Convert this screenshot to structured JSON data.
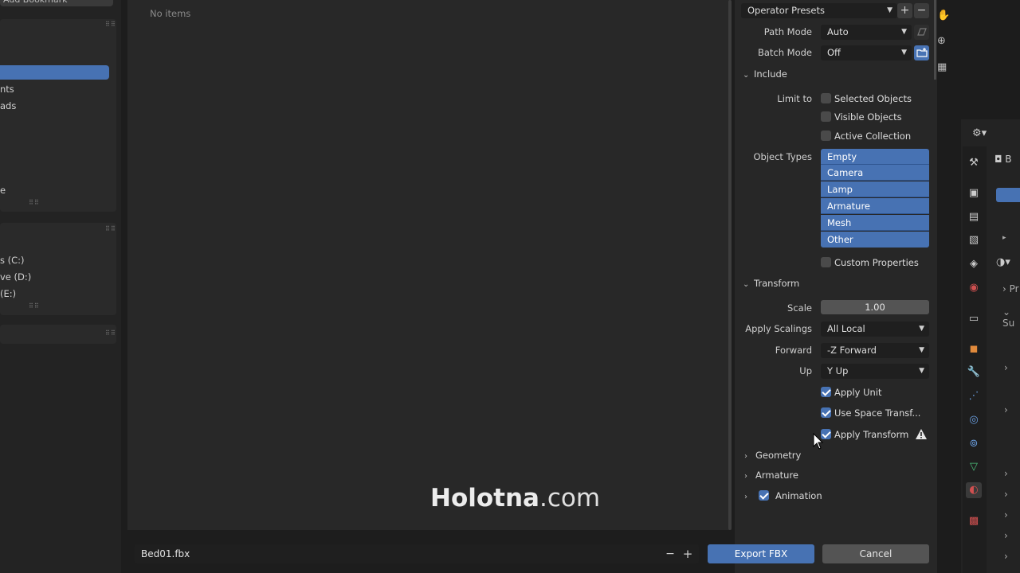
{
  "left_sidebar": {
    "top_button_label": "Add Bookmark",
    "bookmarks": [
      "",
      "nts",
      "ads",
      "",
      "e"
    ],
    "drives": [
      "s (C:)",
      "ve (D:)",
      "(E:)"
    ]
  },
  "main": {
    "empty_text": "No items",
    "watermark_bold": "Holotna",
    "watermark_domain": ".com"
  },
  "options": {
    "presets_label": "Operator Presets",
    "path_mode_label": "Path Mode",
    "path_mode_value": "Auto",
    "batch_mode_label": "Batch Mode",
    "batch_mode_value": "Off",
    "include_header": "Include",
    "limit_to_label": "Limit to",
    "limit_to": [
      {
        "label": "Selected Objects",
        "checked": false
      },
      {
        "label": "Visible Objects",
        "checked": false
      },
      {
        "label": "Active Collection",
        "checked": false
      }
    ],
    "object_types_label": "Object Types",
    "object_types": [
      "Empty",
      "Camera",
      "Lamp",
      "Armature",
      "Mesh",
      "Other"
    ],
    "custom_properties_label": "Custom Properties",
    "transform_header": "Transform",
    "scale_label": "Scale",
    "scale_value": "1.00",
    "apply_scalings_label": "Apply Scalings",
    "apply_scalings_value": "All Local",
    "forward_label": "Forward",
    "forward_value": "-Z Forward",
    "up_label": "Up",
    "up_value": "Y Up",
    "apply_unit_label": "Apply Unit",
    "use_space_transform_label": "Use Space Transf...",
    "apply_transform_label": "Apply Transform",
    "geometry_header": "Geometry",
    "armature_header": "Armature",
    "animation_header": "Animation"
  },
  "bottom": {
    "filename": "Bed01.fbx",
    "minus": "−",
    "plus": "+",
    "export_label": "Export FBX",
    "cancel_label": "Cancel"
  },
  "colors": {
    "accent": "#4772b3",
    "panel": "#272727",
    "background": "#1d1d1d"
  }
}
